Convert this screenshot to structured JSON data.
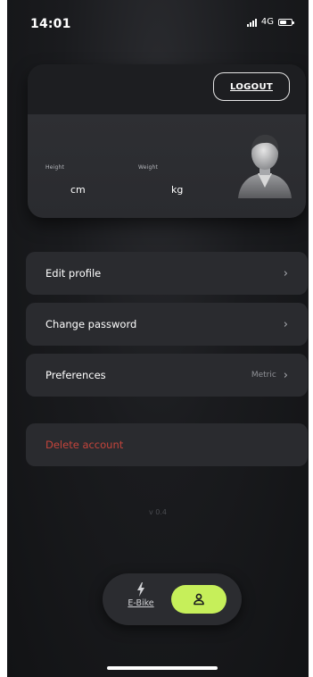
{
  "status_bar": {
    "time": "14:01",
    "network": "4G"
  },
  "profile": {
    "logout_label": "LOGOUT",
    "height_label": "Height",
    "height_unit": "cm",
    "weight_label": "Weight",
    "weight_unit": "kg"
  },
  "menu": {
    "edit_profile": "Edit profile",
    "change_password": "Change password",
    "preferences": "Preferences",
    "preferences_value": "Metric",
    "delete_account": "Delete account"
  },
  "version": "v 0.4",
  "bottom_nav": {
    "ebike_label": "E-Bike"
  },
  "colors": {
    "accent": "#c6ef5a",
    "danger": "#c4443b",
    "card": "#2a2b2f",
    "background": "#1a1b1e"
  },
  "icons": {
    "ebike": "lightning-bolt-icon",
    "profile": "person-icon",
    "menu_chevron": "chevron-right-icon"
  }
}
